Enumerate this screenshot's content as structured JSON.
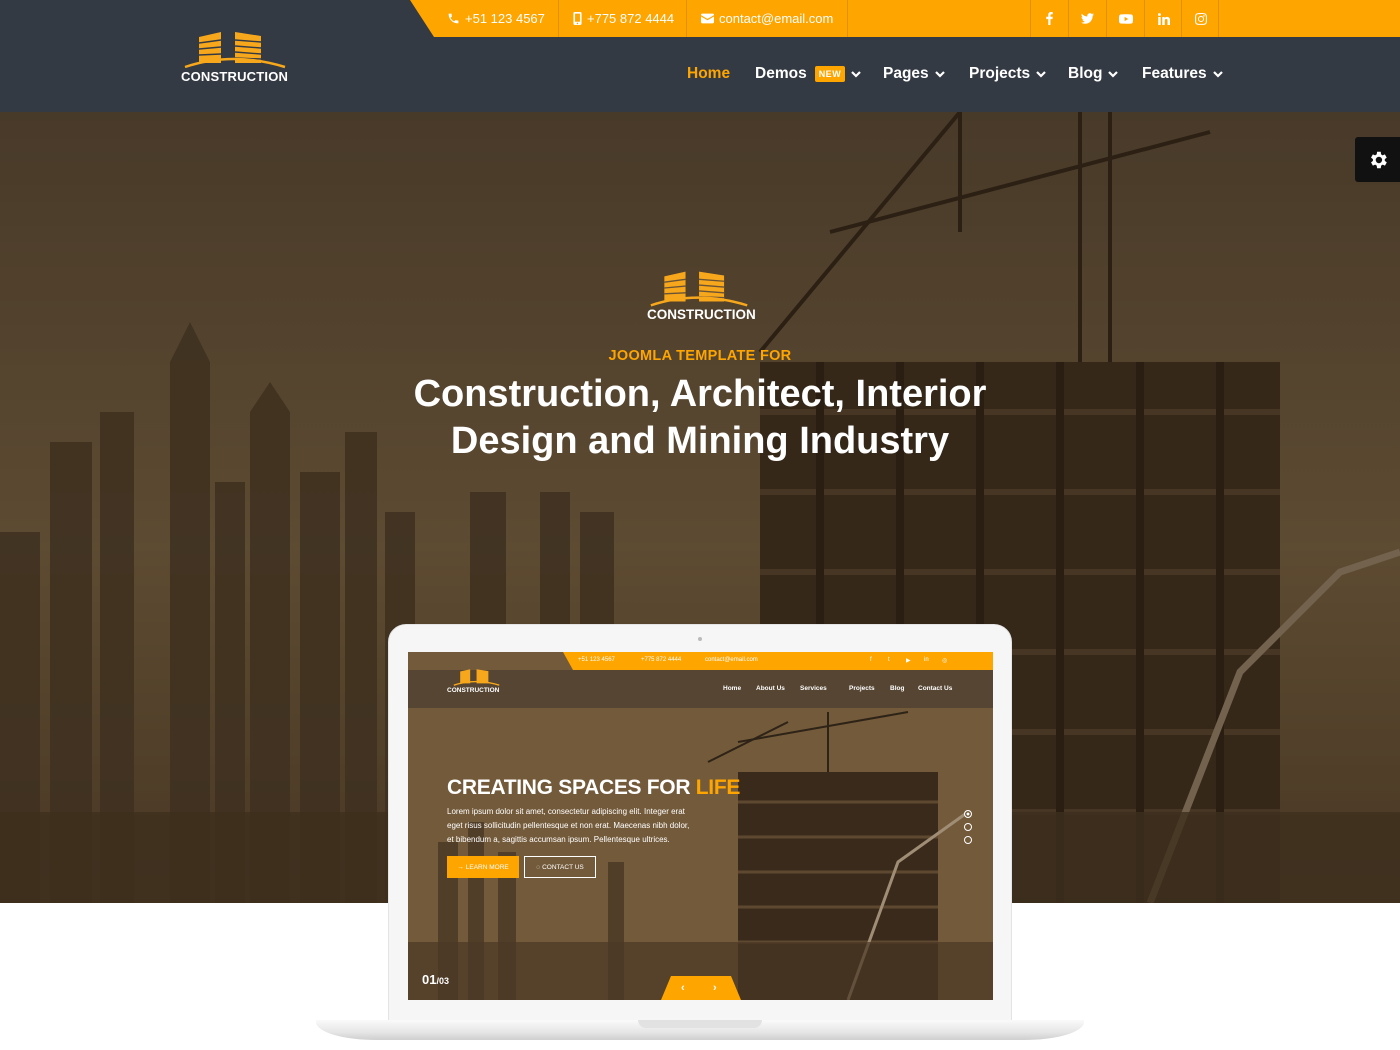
{
  "header": {
    "logo_text": "CONSTRUCTION",
    "contact": {
      "phone": "+51 123 4567",
      "mobile": "+775 872 4444",
      "email": "contact@email.com"
    },
    "social": [
      "facebook-icon",
      "twitter-icon",
      "youtube-icon",
      "linkedin-icon",
      "instagram-icon"
    ],
    "nav": [
      {
        "label": "Home",
        "active": true
      },
      {
        "label": "Demos",
        "badge": "NEW",
        "dropdown": true
      },
      {
        "label": "Pages",
        "dropdown": true
      },
      {
        "label": "Projects",
        "dropdown": true
      },
      {
        "label": "Blog",
        "dropdown": true
      },
      {
        "label": "Features",
        "dropdown": true
      }
    ]
  },
  "hero": {
    "logo_text": "CONSTRUCTION",
    "kicker": "JOOMLA TEMPLATE FOR",
    "title_line1": "Construction, Architect, Interior",
    "title_line2": "Design and Mining Industry"
  },
  "preview": {
    "phone": "+51 123 4567",
    "mobile": "+775 872 4444",
    "email": "contact@email.com",
    "logo_text": "CONSTRUCTION",
    "nav": [
      "Home",
      "About Us",
      "Services",
      "Projects",
      "Blog",
      "Contact Us"
    ],
    "headline": "CREATING SPACES FOR",
    "headline_accent": "LIFE",
    "paragraph_line1": "Lorem ipsum dolor sit amet, consectetur adipiscing elit. Integer erat",
    "paragraph_line2": "eget risus sollicitudin pellentesque et non erat. Maecenas nibh dolor,",
    "paragraph_line3": "et bibendum a, sagittis accumsan ipsum. Pellentesque ultrices.",
    "btn_learn": "LEARN MORE",
    "btn_contact": "CONTACT US",
    "slide_current": "01",
    "slide_total": "/03"
  },
  "colors": {
    "accent": "#ffa500",
    "header_bg": "#343a44",
    "text_light": "#ffffff"
  }
}
